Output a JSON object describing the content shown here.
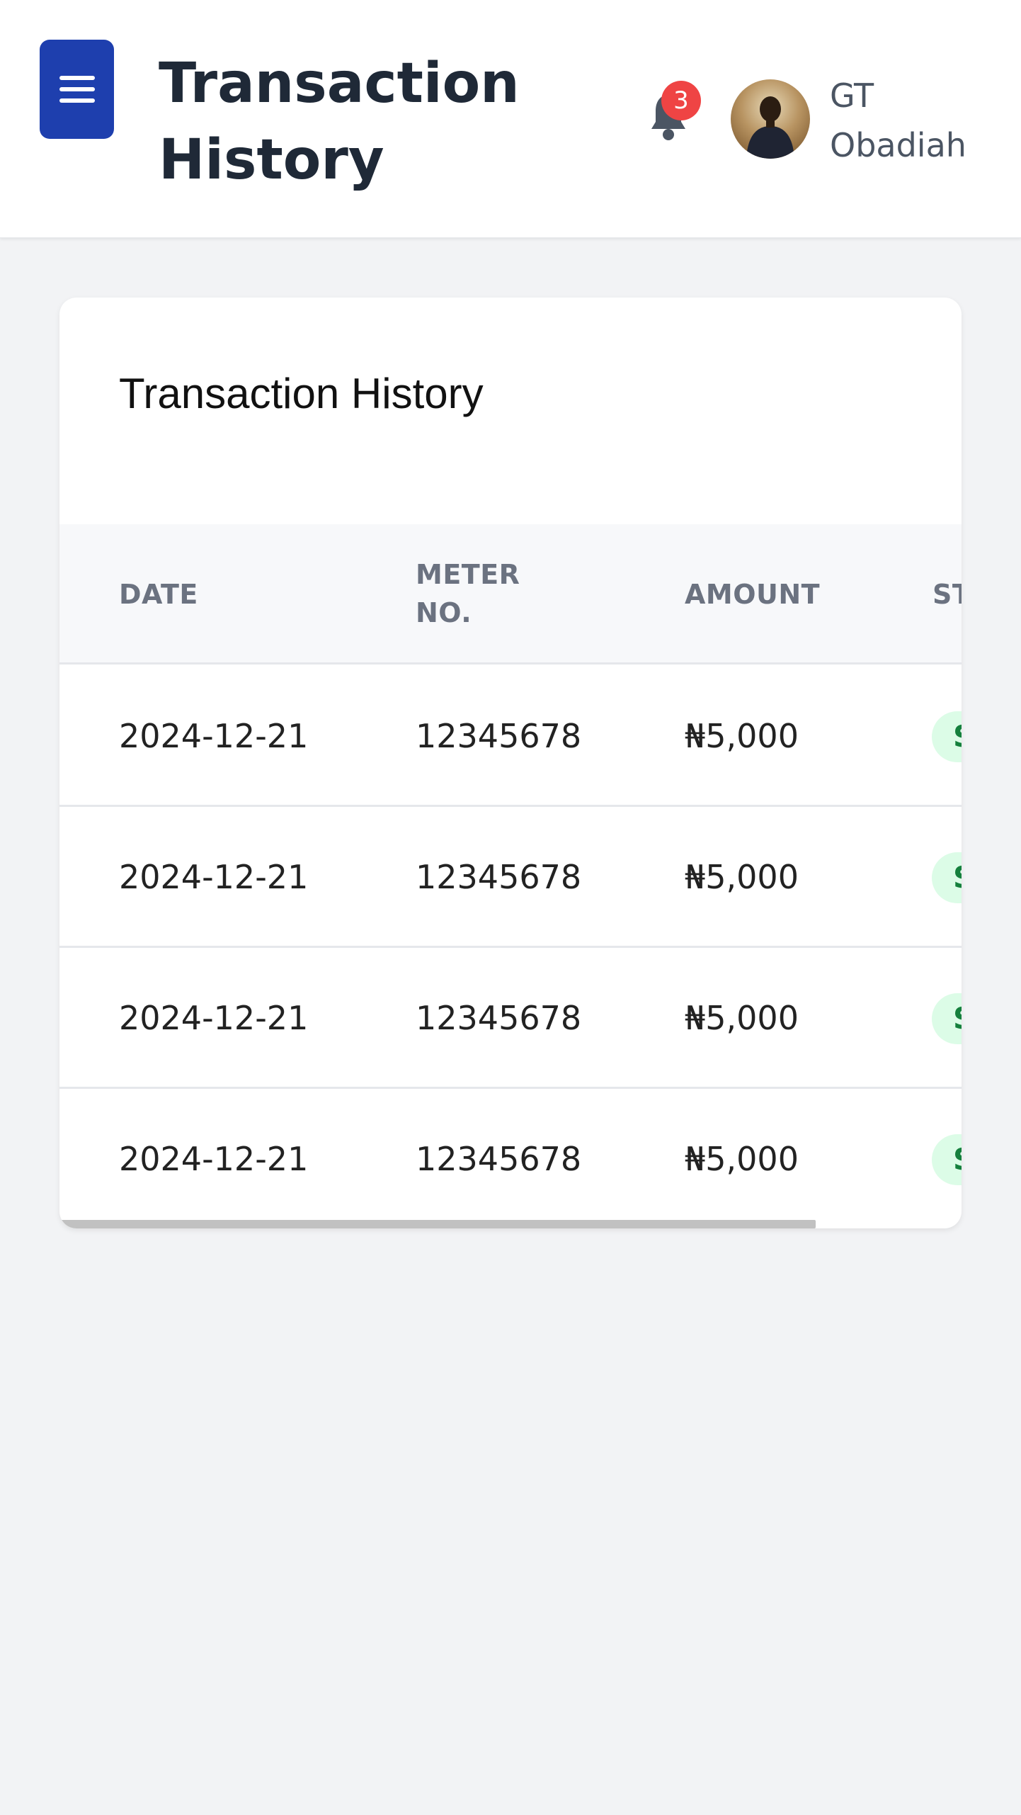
{
  "header": {
    "menu_icon": "hamburger-menu-icon",
    "title": "Transaction History",
    "notifications": {
      "icon": "bell-icon",
      "count": "3"
    },
    "user": {
      "avatar": "user-avatar-photo",
      "name": "GT Obadiah"
    }
  },
  "card": {
    "title": "Transaction History",
    "columns": [
      "DATE",
      "METER NO.",
      "AMOUNT",
      "ST"
    ],
    "rows": [
      {
        "date": "2024-12-21",
        "meter": "12345678",
        "amount": "₦5,000",
        "status": "S"
      },
      {
        "date": "2024-12-21",
        "meter": "12345678",
        "amount": "₦5,000",
        "status": "S"
      },
      {
        "date": "2024-12-21",
        "meter": "12345678",
        "amount": "₦5,000",
        "status": "S"
      },
      {
        "date": "2024-12-21",
        "meter": "12345678",
        "amount": "₦5,000",
        "status": "S"
      }
    ]
  },
  "colors": {
    "accent": "#1e3fae",
    "badge": "#ef4444",
    "status_bg": "#dcfce7",
    "status_text": "#15803d",
    "page_bg": "#f2f3f5"
  }
}
